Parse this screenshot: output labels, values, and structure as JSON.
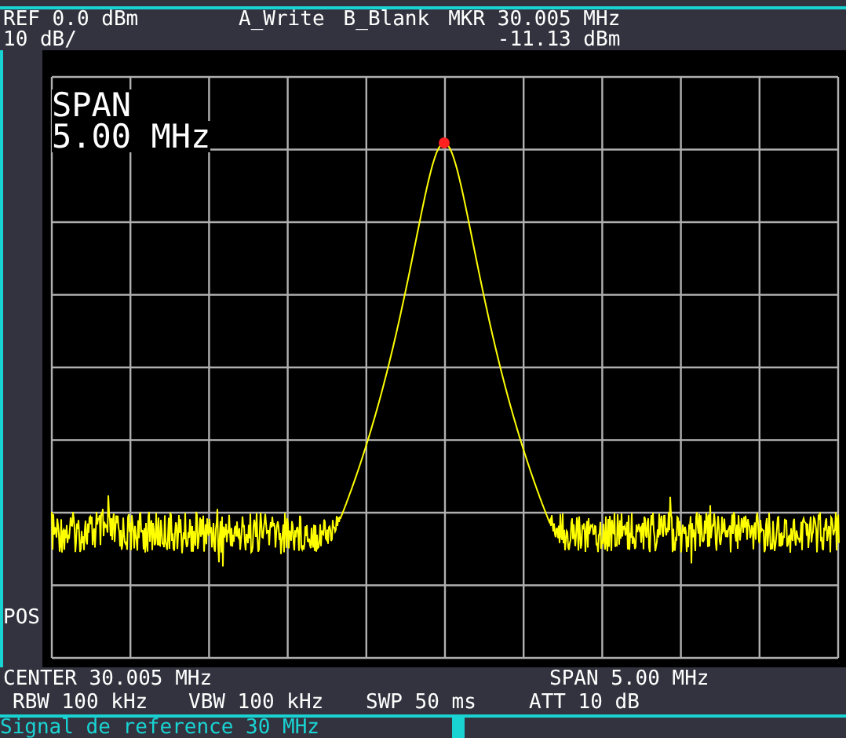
{
  "header": {
    "ref": "REF 0.0 dBm",
    "scale": "10 dB/",
    "trace_a": "A_Write",
    "trace_b": "B_Blank",
    "marker_freq": "MKR 30.005 MHz",
    "marker_level": "-11.13 dBm"
  },
  "span_overlay": [
    "SPAN",
    "5.00 MHz"
  ],
  "side_label": "POS",
  "footer": {
    "center": "CENTER 30.005 MHz",
    "span": "SPAN 5.00 MHz",
    "rbw": "RBW 100 kHz",
    "vbw": "VBW 100 kHz",
    "swp": "SWP 50 ms",
    "att": "ATT 10 dB"
  },
  "status": "Signal de reference 30 MHz"
}
